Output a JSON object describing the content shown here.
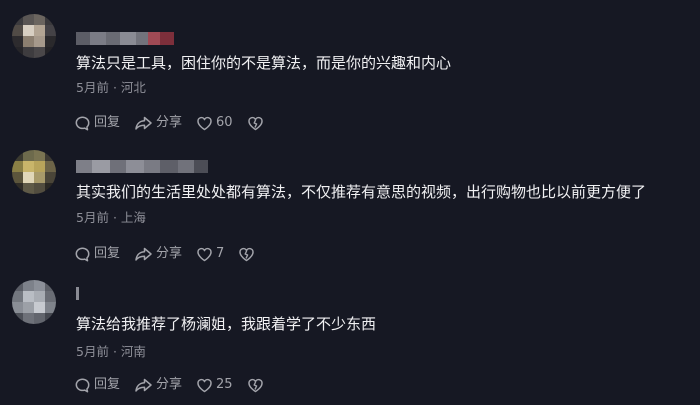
{
  "common": {
    "reply_label": "回复",
    "share_label": "分享"
  },
  "comments": [
    {
      "text": "算法只是工具，困住你的不是算法，而是你的兴趣和内心",
      "time": "5月前",
      "sep": "·",
      "location": "河北",
      "likes": "60"
    },
    {
      "text": "其实我们的生活里处处都有算法，不仅推荐有意思的视频，出行购物也比以前更方便了",
      "time": "5月前",
      "sep": "·",
      "location": "上海",
      "likes": "7"
    },
    {
      "text": "算法给我推荐了杨澜姐，我跟着学了不少东西",
      "time": "5月前",
      "sep": "·",
      "location": "河南",
      "likes": "25"
    }
  ],
  "colors": {
    "background": "#161823",
    "text": "#f1f1f3",
    "meta": "#8f9099",
    "action": "#a3a4ab"
  }
}
